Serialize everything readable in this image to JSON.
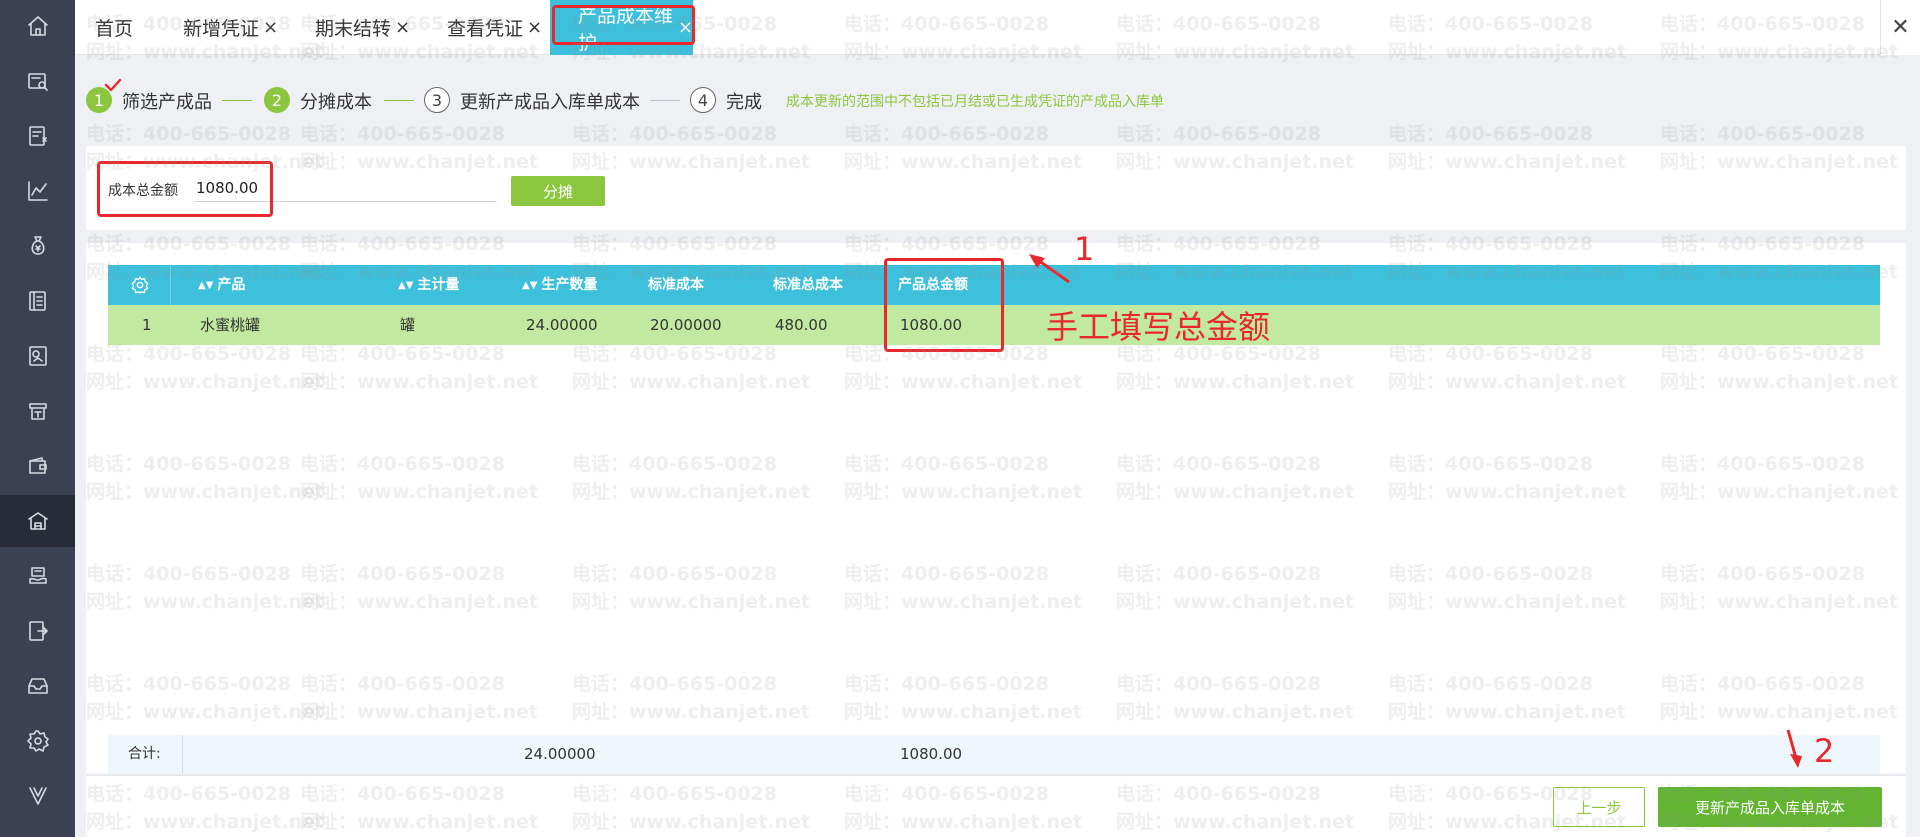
{
  "tabs": [
    {
      "label": "首页",
      "closable": false
    },
    {
      "label": "新增凭证",
      "closable": true
    },
    {
      "label": "期末结转",
      "closable": true
    },
    {
      "label": "查看凭证",
      "closable": true
    },
    {
      "label": "产品成本维护",
      "closable": true,
      "active": true
    }
  ],
  "tab_close_glyph": "×",
  "close_all_glyph": "✕",
  "steps": [
    {
      "num": "1",
      "label": "筛选产成品",
      "state": "done"
    },
    {
      "num": "2",
      "label": "分摊成本",
      "state": "current"
    },
    {
      "num": "3",
      "label": "更新产成品入库单成本",
      "state": "todo"
    },
    {
      "num": "4",
      "label": "完成",
      "state": "todo"
    }
  ],
  "steps_note": "成本更新的范围中不包括已月结或已生成凭证的产成品入库单",
  "cost": {
    "label": "成本总金额",
    "value": "1080.00",
    "allocate_button": "分摊"
  },
  "table": {
    "columns": [
      "产品",
      "主计量",
      "生产数量",
      "标准成本",
      "标准总成本",
      "产品总金额"
    ],
    "rows": [
      {
        "index": "1",
        "product": "水蜜桃罐",
        "unit": "罐",
        "quantity": "24.00000",
        "standard_cost": "20.00000",
        "standard_total": "480.00",
        "product_total": "1080.00"
      }
    ]
  },
  "totals": {
    "label": "合计:",
    "quantity": "24.00000",
    "product_total": "1080.00"
  },
  "buttons": {
    "prev": "上一步",
    "update": "更新产成品入库单成本"
  },
  "annotations": {
    "marker1": "1",
    "marker2": "2",
    "note": "手工填写总金额"
  },
  "watermark": {
    "phone": "电话：400-665-0028",
    "site": "网址：www.chanjet.net"
  },
  "sidebar_icons": [
    "home-icon",
    "voucher-search-icon",
    "voucher-entry-icon",
    "chart-icon",
    "money-bag-icon",
    "ledger-icon",
    "report-icon",
    "cashier-icon",
    "wallet-icon",
    "warehouse-icon",
    "payroll-icon",
    "export-icon",
    "archive-icon",
    "settings-icon",
    "logo-v-icon"
  ],
  "colors": {
    "accent_cyan": "#3cc0dc",
    "accent_green": "#8cc63f",
    "update_green": "#62b431",
    "row_green": "#c2e9a0",
    "annotation_red": "#e8282d",
    "sidebar": "#3a4150"
  }
}
